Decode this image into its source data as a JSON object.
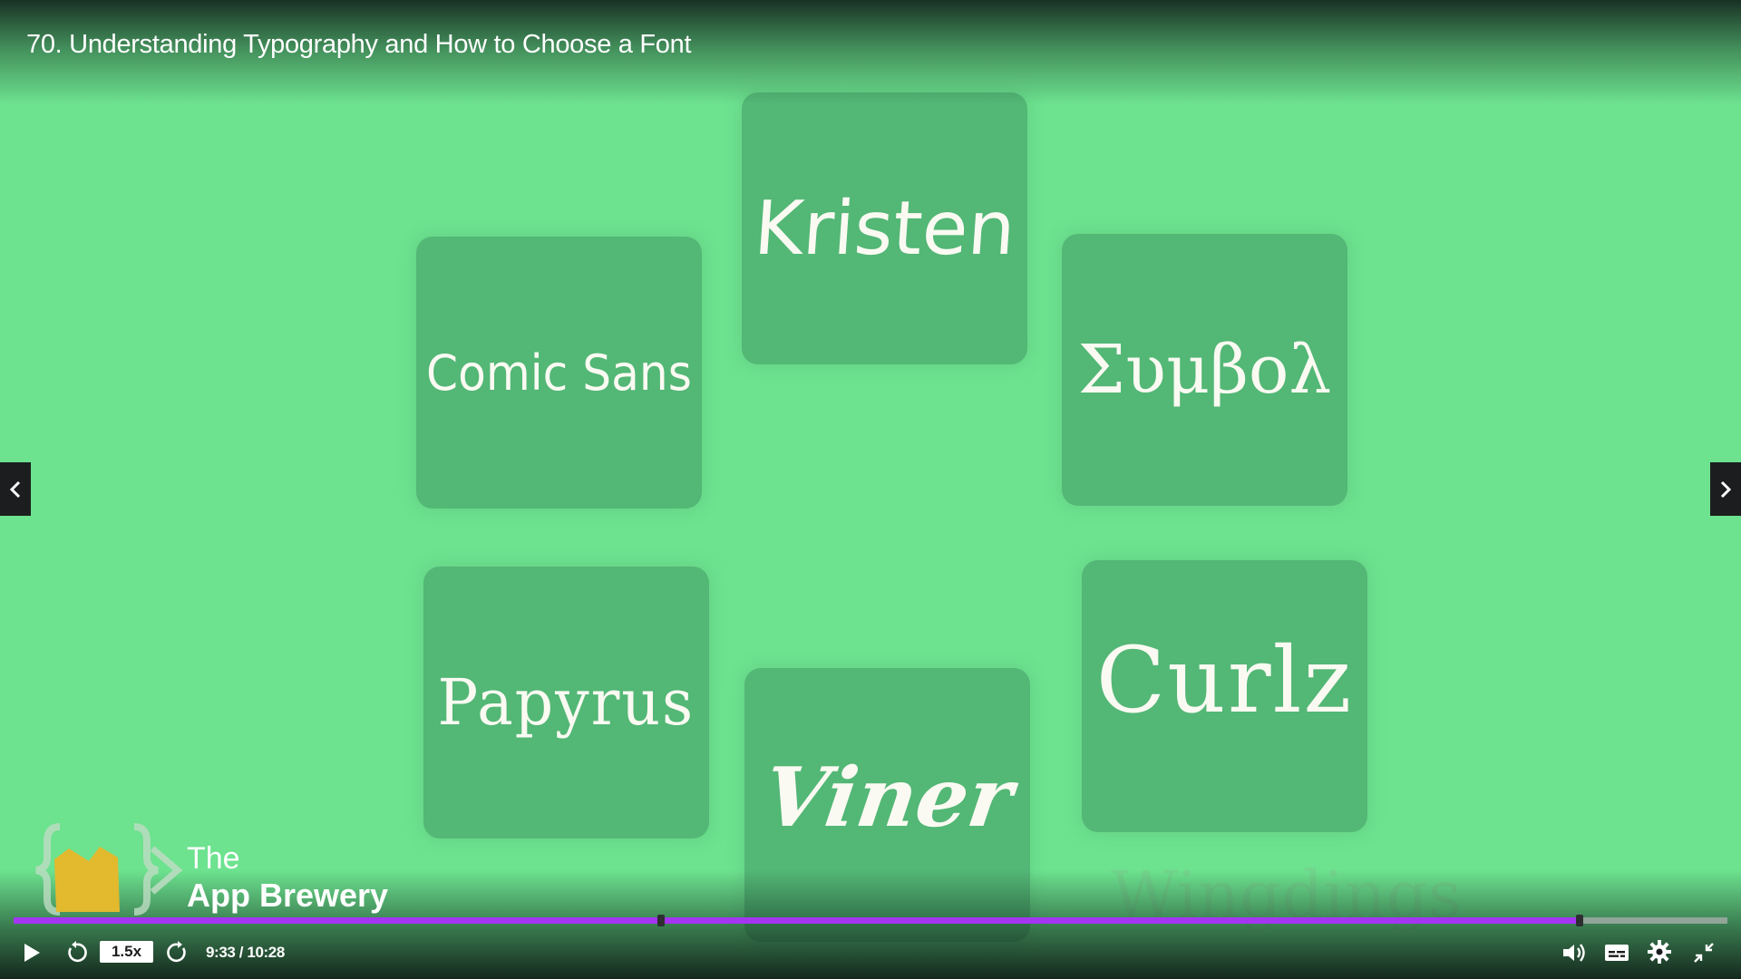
{
  "lecture": {
    "title": "70. Understanding Typography and How to Choose a Font"
  },
  "slide": {
    "cards": [
      {
        "label": "Kristen"
      },
      {
        "label": "Comic Sans"
      },
      {
        "label": "Συμβολ"
      },
      {
        "label": "Papyrus"
      },
      {
        "label": "Viner"
      },
      {
        "label": "Curlz"
      }
    ],
    "faded_text": "Wingdings",
    "colors": {
      "background": "#6de28f",
      "card": "#53b776",
      "card_text": "#fafaf2"
    }
  },
  "watermark": {
    "line1": "The",
    "line2": "App Brewery"
  },
  "player": {
    "progress": {
      "played_fraction": 0.914,
      "markers": [
        0.378,
        0.914
      ],
      "accent": "#a435f0"
    },
    "speed_label": "1.5x",
    "time_display": "9:33 / 10:28",
    "icons": {
      "play": "play-icon",
      "rewind": "rewind-icon",
      "forward": "forward-icon",
      "volume": "volume-icon",
      "captions": "captions-icon",
      "settings": "gear-icon",
      "fullscreen": "exit-fullscreen-icon",
      "prev": "chevron-left-icon",
      "next": "chevron-right-icon"
    }
  }
}
